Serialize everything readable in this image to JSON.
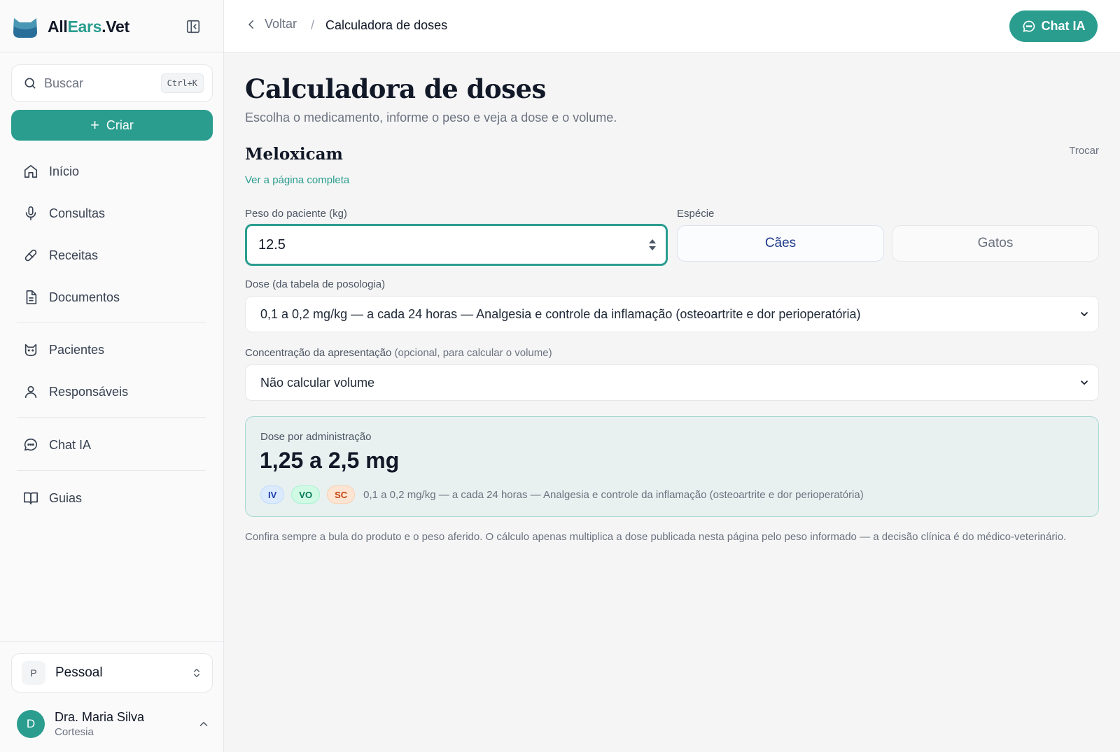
{
  "brand": {
    "part1": "All",
    "part2": "Ears",
    "part3": ".Vet"
  },
  "search": {
    "placeholder": "Buscar",
    "shortcut": "Ctrl+K"
  },
  "create_button": {
    "label": "Criar"
  },
  "nav": {
    "items": [
      {
        "label": "Início",
        "icon": "home-icon"
      },
      {
        "label": "Consultas",
        "icon": "microphone-icon"
      },
      {
        "label": "Receitas",
        "icon": "pill-icon"
      },
      {
        "label": "Documentos",
        "icon": "document-icon"
      },
      {
        "label": "Pacientes",
        "icon": "cat-icon"
      },
      {
        "label": "Responsáveis",
        "icon": "user-icon"
      },
      {
        "label": "Chat IA",
        "icon": "chat-icon"
      },
      {
        "label": "Guias",
        "icon": "book-icon"
      }
    ]
  },
  "org": {
    "initial": "P",
    "name": "Pessoal"
  },
  "user": {
    "initial": "D",
    "name": "Dra. Maria Silva",
    "subtitle": "Cortesia"
  },
  "header": {
    "back_label": "Voltar",
    "separator": "/",
    "current": "Calculadora de doses",
    "chat_button": "Chat IA"
  },
  "page": {
    "title": "Calculadora de doses",
    "subtitle": "Escolha o medicamento, informe o peso e veja a dose e o volume."
  },
  "medication": {
    "name": "Meloxicam",
    "link": "Ver a página completa",
    "swap": "Trocar"
  },
  "form": {
    "weight_label": "Peso do paciente (kg)",
    "weight_value": "12.5",
    "species_label": "Espécie",
    "species_options": [
      "Cães",
      "Gatos"
    ],
    "species_selected": "Cães",
    "dose_label": "Dose (da tabela de posologia)",
    "dose_value": "0,1 a 0,2 mg/kg — a cada 24 horas — Analgesia e controle da inflamação (osteoartrite e dor perioperatória)",
    "concentration_label": "Concentração da apresentação",
    "concentration_hint": "(opcional, para calcular o volume)",
    "concentration_value": "Não calcular volume"
  },
  "result": {
    "label": "Dose por administração",
    "value": "1,25 a 2,5 mg",
    "routes": [
      "IV",
      "VO",
      "SC"
    ],
    "description": "0,1 a 0,2 mg/kg — a cada 24 horas — Analgesia e controle da inflamação (osteoartrite e dor perioperatória)"
  },
  "disclaimer": "Confira sempre a bula do produto e o peso aferido. O cálculo apenas multiplica a dose publicada nesta página pelo peso informado — a decisão clínica é do médico-veterinário.",
  "colors": {
    "accent": "#2a9d8f",
    "result_bg": "#e8f1f0",
    "result_border": "#a9d8d1"
  }
}
